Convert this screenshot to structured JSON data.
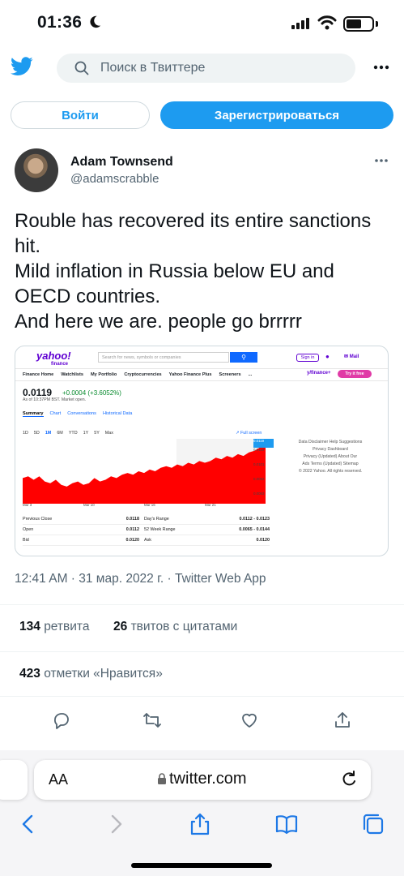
{
  "status_bar": {
    "time": "01:36"
  },
  "header": {
    "search_placeholder": "Поиск в Твиттере"
  },
  "auth": {
    "login_label": "Войти",
    "signup_label": "Зарегистрироваться"
  },
  "tweet": {
    "author_name": "Adam Townsend",
    "author_handle": "@adamscrabble",
    "text": "Rouble has recovered its entire sanctions hit.\nMild inflation in Russia below EU and OECD countries.\nAnd here we are. people go brrrrr",
    "timestamp": "12:41 AM · 31 мар. 2022 г. · Twitter Web App",
    "retweets_count": "134",
    "retweets_label": "ретвита",
    "quotes_count": "26",
    "quotes_label": "твитов с цитатами",
    "likes_count": "423",
    "likes_label": "отметки «Нравится»"
  },
  "embedded_image": {
    "logo": "yahoo!",
    "logo_sub": "finance",
    "search_placeholder": "Search for news, symbols or companies",
    "sign_in": "Sign in",
    "mail": "Mail",
    "nav": [
      "Finance Home",
      "Watchlists",
      "My Portfolio",
      "Cryptocurrencies",
      "Yahoo Finance Plus",
      "Screeners",
      "..."
    ],
    "premium_brand": "y/finance+",
    "premium_cta": "Try it free",
    "price": "0.0119",
    "change": "+0.0004 (+3.6052%)",
    "as_of": "As of 10:37PM BST. Market open.",
    "tabs": [
      "Summary",
      "Chart",
      "Conversations",
      "Historical Data"
    ],
    "ranges": [
      "1D",
      "5D",
      "1M",
      "6M",
      "YTD",
      "1Y",
      "5Y",
      "Max"
    ],
    "full_screen": "Full screen",
    "y_ticks": [
      "0.0119",
      "0.0110",
      "0.0101",
      "0.0092",
      "0.0083"
    ],
    "x_ticks": [
      "Mar 3",
      "Mar 10",
      "Mar 16",
      "Mar 21"
    ],
    "side_links": [
      "Data Disclaimer  Help  Suggestions",
      "Privacy Dashboard",
      "Privacy (Updated)  About Our",
      "Ads  Terms (Updated)  Sitemap",
      "© 2022 Yahoo. All rights reserved."
    ],
    "table": [
      [
        "Previous Close",
        "0.0118",
        "Day's Range",
        "0.0112 - 0.0123"
      ],
      [
        "Open",
        "0.0112",
        "52 Week Range",
        "0.0065 - 0.0144"
      ],
      [
        "Bid",
        "0.0120",
        "Ask",
        "0.0120"
      ]
    ],
    "series_color": "#ff0000",
    "series": [
      0.0098,
      0.0099,
      0.0097,
      0.0099,
      0.0096,
      0.0095,
      0.0097,
      0.0094,
      0.0093,
      0.0095,
      0.0096,
      0.0094,
      0.0095,
      0.0098,
      0.0096,
      0.0097,
      0.0099,
      0.0098,
      0.01,
      0.0101,
      0.01,
      0.0102,
      0.0101,
      0.0103,
      0.0102,
      0.0104,
      0.0105,
      0.0104,
      0.0106,
      0.0105,
      0.0107,
      0.0106,
      0.0108,
      0.0107,
      0.0108,
      0.011,
      0.0109,
      0.0111,
      0.011,
      0.0112,
      0.0111,
      0.0113,
      0.0114,
      0.0116,
      0.0119
    ]
  },
  "browser": {
    "aa_label": "AA",
    "url": "twitter.com"
  },
  "colors": {
    "accent": "#1d9bf0"
  },
  "icons": [
    "moon-icon",
    "signal-icon",
    "wifi-icon",
    "battery-icon",
    "twitter-logo-icon",
    "search-icon",
    "more-icon",
    "reply-icon",
    "retweet-icon",
    "like-icon",
    "share-icon",
    "lock-icon",
    "reload-icon",
    "back-icon",
    "forward-icon",
    "share-sheet-icon",
    "bookmarks-icon",
    "tabs-icon"
  ]
}
